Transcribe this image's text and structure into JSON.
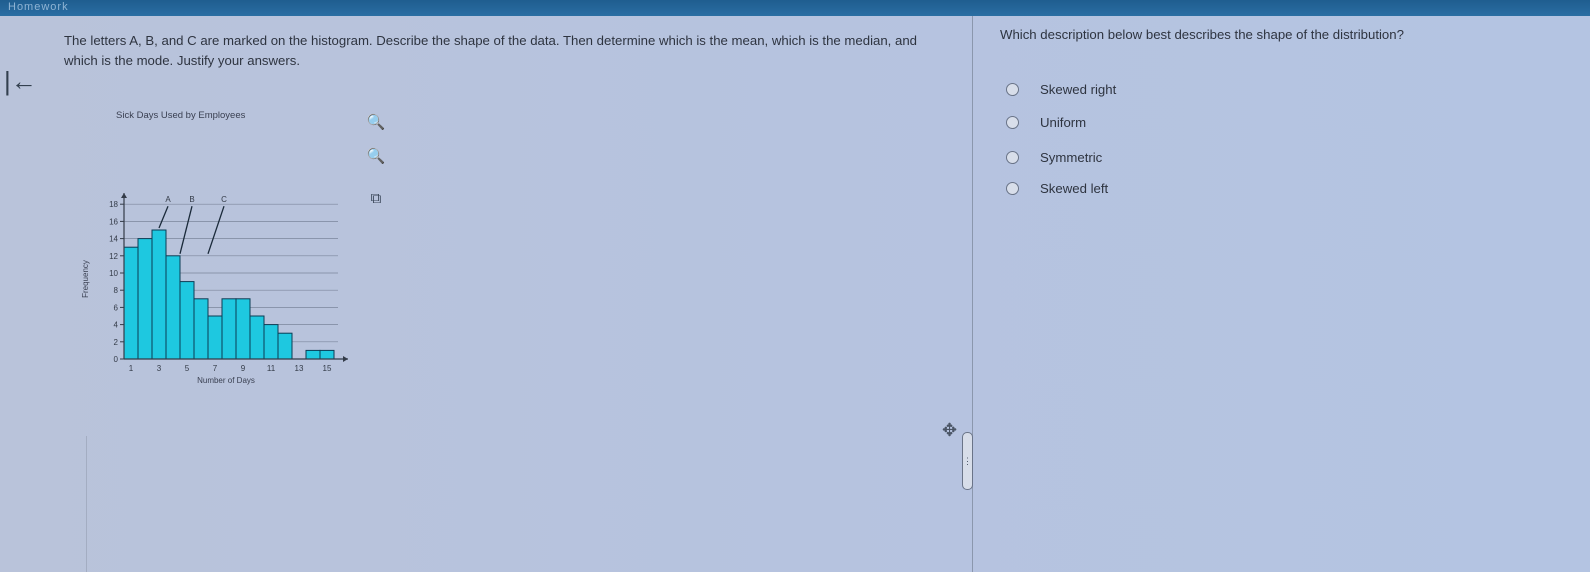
{
  "header": {
    "title": "Homework"
  },
  "question": {
    "text": "The letters A, B, and C are marked on the histogram. Describe the shape of the data. Then determine which is the mean, which is the median, and which is the mode. Justify your answers."
  },
  "tools": [
    "zoom-in-icon",
    "zoom-out-icon",
    "open-external-icon"
  ],
  "prompt": "Which description below best describes the shape of the distribution?",
  "options": [
    {
      "label": "Skewed right"
    },
    {
      "label": "Uniform"
    },
    {
      "label": "Symmetric"
    },
    {
      "label": "Skewed left"
    }
  ],
  "colors": {
    "bar_fill": "#1ec8e0",
    "bar_stroke": "#0a3d55",
    "arrow": "#1a2a3a"
  },
  "chart_data": {
    "type": "bar",
    "title": "Sick Days Used by Employees",
    "xlabel": "Number of Days",
    "ylabel": "Frequency",
    "x": [
      0,
      1,
      2,
      3,
      4,
      5,
      6,
      7,
      8,
      9,
      10,
      11,
      12,
      13,
      14
    ],
    "values": [
      13,
      14,
      15,
      12,
      9,
      7,
      5,
      7,
      7,
      5,
      4,
      3,
      0,
      1,
      1
    ],
    "ylim": [
      0,
      18
    ],
    "yticks": [
      0,
      2,
      4,
      6,
      8,
      10,
      12,
      14,
      16,
      18
    ],
    "xtick_labels": [
      "1",
      "3",
      "5",
      "7",
      "9",
      "11",
      "13",
      "15"
    ],
    "markers": [
      {
        "label": "A",
        "x": 2,
        "y": 15
      },
      {
        "label": "B",
        "x": 3.5,
        "y": 12
      },
      {
        "label": "C",
        "x": 5.5,
        "y": 12
      }
    ]
  }
}
